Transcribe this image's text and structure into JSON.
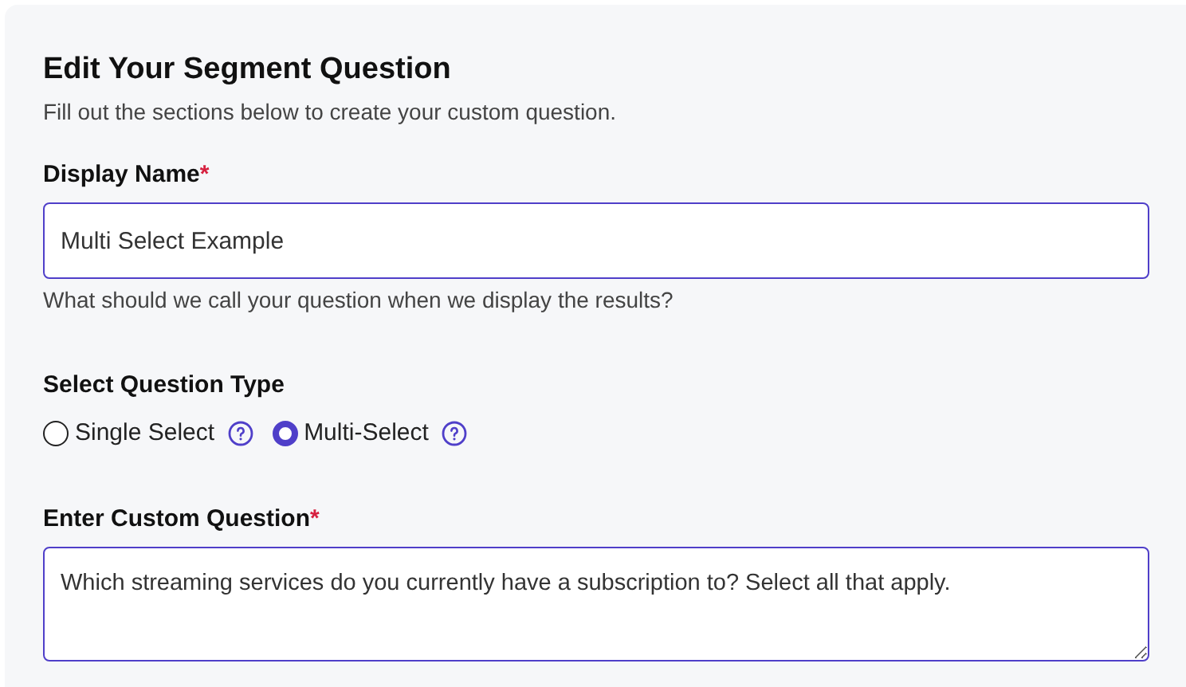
{
  "title": "Edit Your Segment Question",
  "subtitle": "Fill out the sections below to create your custom question.",
  "display_name": {
    "label": "Display Name",
    "required_mark": "*",
    "value": "Multi Select Example",
    "help": "What should we call your question when we display the results?"
  },
  "question_type": {
    "label": "Select Question Type",
    "options": [
      {
        "label": "Single Select",
        "selected": false
      },
      {
        "label": "Multi-Select",
        "selected": true
      }
    ]
  },
  "custom_question": {
    "label": "Enter Custom Question",
    "required_mark": "*",
    "value": "Which streaming services do you currently have a subscription to? Select all that apply."
  }
}
